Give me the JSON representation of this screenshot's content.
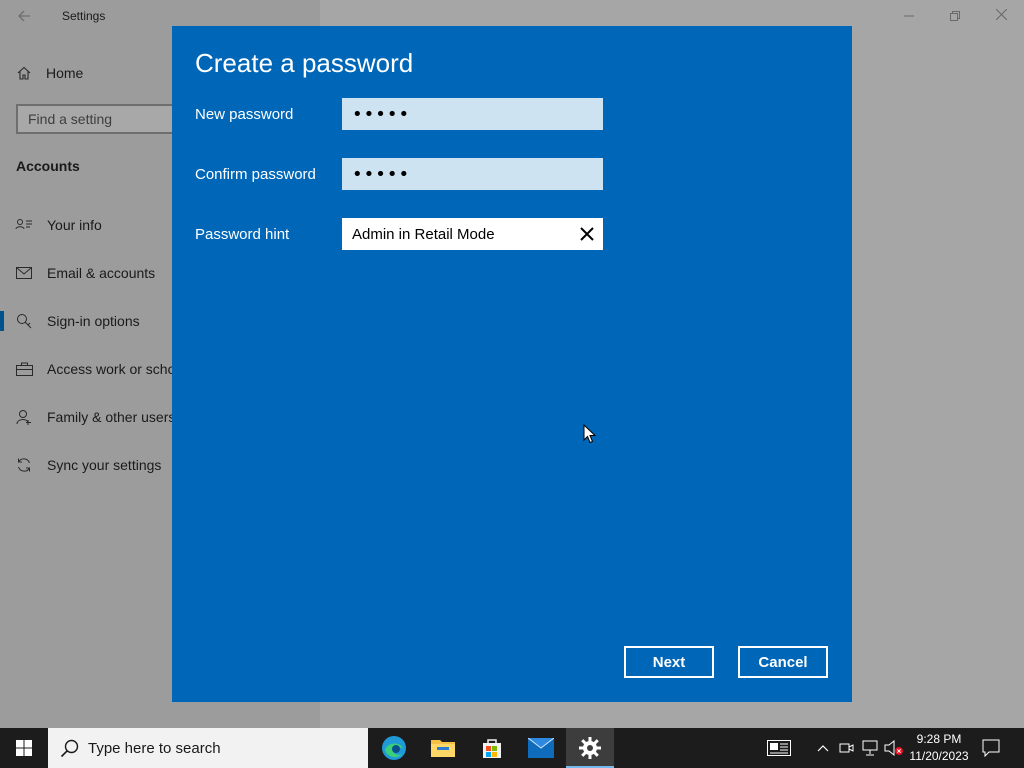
{
  "window": {
    "title": "Settings",
    "controls": {
      "minimize": "—",
      "maximize": "❐",
      "close": "✕"
    }
  },
  "sidebar": {
    "home_label": "Home",
    "search_placeholder": "Find a setting",
    "section_title": "Accounts",
    "items": [
      {
        "label": "Your info",
        "icon": "person-card-icon",
        "selected": false
      },
      {
        "label": "Email & accounts",
        "icon": "mail-icon",
        "selected": false
      },
      {
        "label": "Sign-in options",
        "icon": "key-icon",
        "selected": true
      },
      {
        "label": "Access work or school",
        "icon": "briefcase-icon",
        "selected": false
      },
      {
        "label": "Family & other users",
        "icon": "person-add-icon",
        "selected": false
      },
      {
        "label": "Sync your settings",
        "icon": "sync-icon",
        "selected": false
      }
    ]
  },
  "dialog": {
    "title": "Create a password",
    "new_password_label": "New password",
    "new_password_value": "•••••",
    "confirm_password_label": "Confirm password",
    "confirm_password_value": "•••••",
    "hint_label": "Password hint",
    "hint_value": "Admin in Retail Mode",
    "next_label": "Next",
    "cancel_label": "Cancel",
    "accent_color": "#0067b8"
  },
  "taskbar": {
    "search_placeholder": "Type here to search",
    "apps": [
      {
        "name": "Microsoft Edge",
        "icon": "edge-icon"
      },
      {
        "name": "File Explorer",
        "icon": "folder-icon"
      },
      {
        "name": "Microsoft Store",
        "icon": "store-icon"
      },
      {
        "name": "Mail",
        "icon": "mail-app-icon"
      },
      {
        "name": "Settings",
        "icon": "gear-icon",
        "active": true
      }
    ],
    "time": "9:28 PM",
    "date": "11/20/2023"
  }
}
